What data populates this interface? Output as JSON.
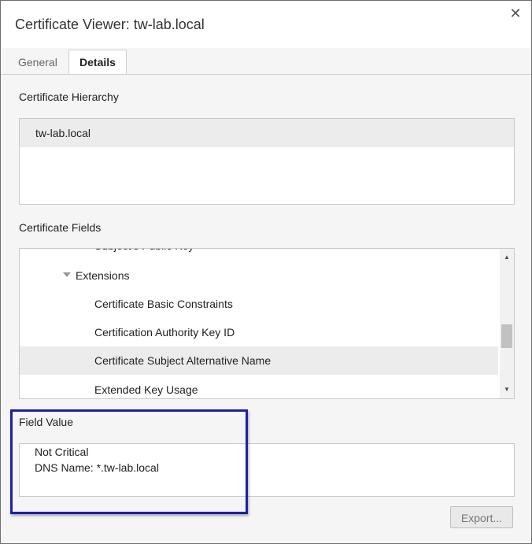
{
  "window": {
    "title": "Certificate Viewer: tw-lab.local",
    "close_symbol": "✕"
  },
  "tabs": [
    {
      "label": "General",
      "active": false
    },
    {
      "label": "Details",
      "active": true
    }
  ],
  "hierarchy": {
    "label": "Certificate Hierarchy",
    "items": [
      "tw-lab.local"
    ]
  },
  "fields": {
    "label": "Certificate Fields",
    "items": [
      {
        "label": "Subject's Public Key",
        "indent": 2,
        "partial": true
      },
      {
        "label": "Extensions",
        "indent": 1,
        "expanded": true
      },
      {
        "label": "Certificate Basic Constraints",
        "indent": 2
      },
      {
        "label": "Certification Authority Key ID",
        "indent": 2
      },
      {
        "label": "Certificate Subject Alternative Name",
        "indent": 2,
        "selected": true
      },
      {
        "label": "Extended Key Usage",
        "indent": 2
      }
    ]
  },
  "field_value": {
    "label": "Field Value",
    "lines": [
      "Not Critical",
      "DNS Name: *.tw-lab.local"
    ]
  },
  "buttons": {
    "export_label": "Export..."
  },
  "colors": {
    "highlight_border": "#1f1fa6",
    "selected_row": "#ececec"
  }
}
